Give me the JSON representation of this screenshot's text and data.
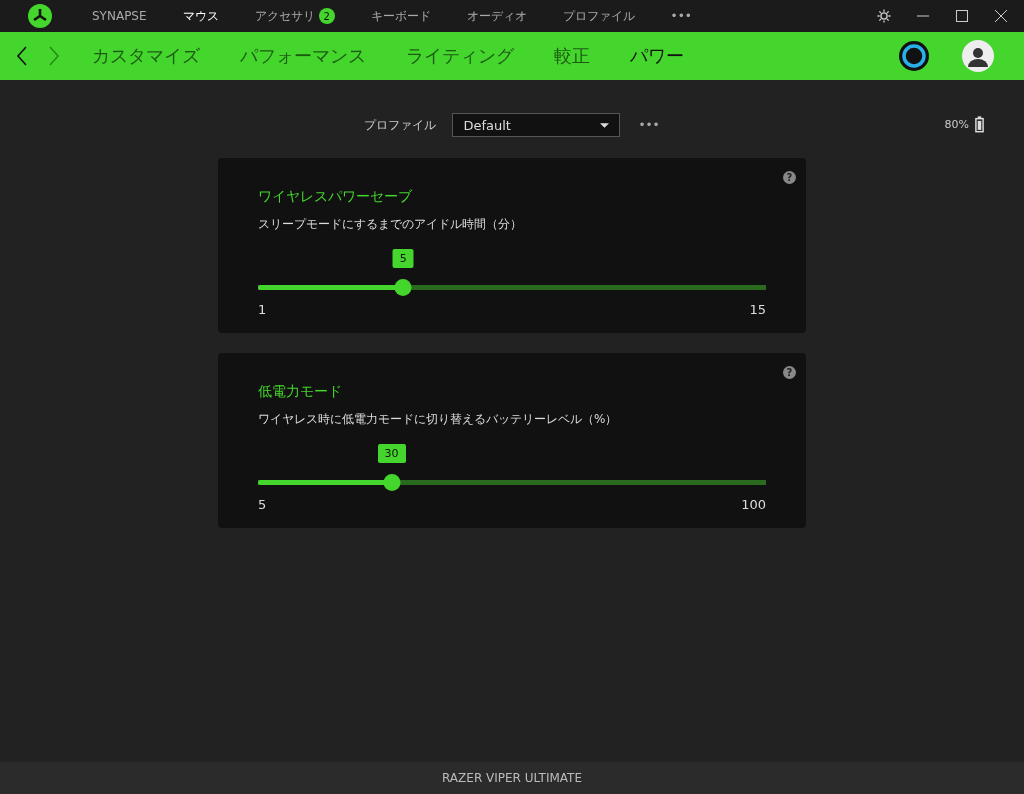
{
  "top_nav": {
    "items": [
      {
        "label": "SYNAPSE",
        "selected": false
      },
      {
        "label": "マウス",
        "selected": true
      },
      {
        "label": "アクセサリ",
        "selected": false,
        "badge": "2"
      },
      {
        "label": "キーボード",
        "selected": false
      },
      {
        "label": "オーディオ",
        "selected": false
      },
      {
        "label": "プロファイル",
        "selected": false
      },
      {
        "label": "•••",
        "selected": false
      }
    ]
  },
  "sub_nav": {
    "tabs": [
      {
        "label": "カスタマイズ",
        "selected": false
      },
      {
        "label": "パフォーマンス",
        "selected": false
      },
      {
        "label": "ライティング",
        "selected": false
      },
      {
        "label": "較正",
        "selected": false
      },
      {
        "label": "パワー",
        "selected": true
      }
    ]
  },
  "profile": {
    "label": "プロファイル",
    "value": "Default",
    "more": "•••"
  },
  "battery": {
    "reading": "80%"
  },
  "panels": [
    {
      "title": "ワイヤレスパワーセーブ",
      "description": "スリープモードにするまでのアイドル時間（分）",
      "help": "?",
      "value": "5",
      "level": 0.286,
      "min": "1",
      "max": "15"
    },
    {
      "title": "低電力モード",
      "description": "ワイヤレス時に低電力モードに切り替えるバッテリーレベル（%）",
      "help": "?",
      "value": "30",
      "level": 0.263,
      "min": "5",
      "max": "100"
    }
  ],
  "status_bar": {
    "device": "RAZER VIPER ULTIMATE"
  }
}
